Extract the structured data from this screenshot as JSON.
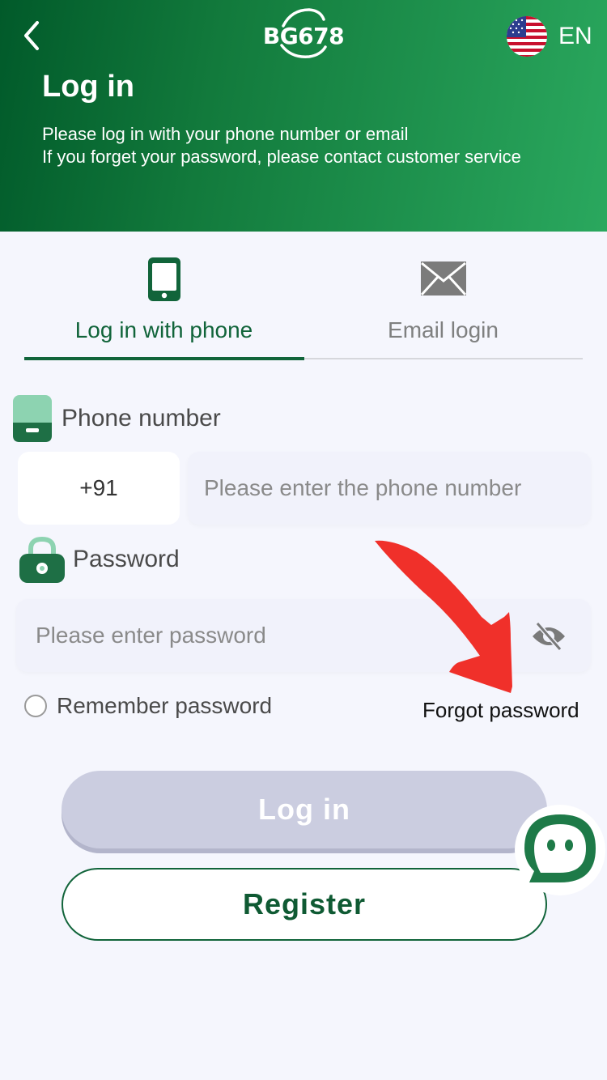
{
  "header": {
    "logo": "BG678",
    "language": "EN",
    "title": "Log in",
    "subtitle_line1": "Please log in with your phone number or email",
    "subtitle_line2": "If you forget your password, please contact customer service"
  },
  "tabs": [
    {
      "label": "Log in with phone",
      "icon": "phone-icon",
      "active": true
    },
    {
      "label": "Email login",
      "icon": "envelope-icon",
      "active": false
    }
  ],
  "phone": {
    "label": "Phone number",
    "country_code": "+91",
    "placeholder": "Please enter the phone number"
  },
  "password": {
    "label": "Password",
    "placeholder": "Please enter password"
  },
  "options": {
    "remember": "Remember password",
    "forgot": "Forgot password"
  },
  "buttons": {
    "login": "Log in",
    "register": "Register"
  },
  "colors": {
    "primary": "#11643a",
    "header_start": "#015a2a",
    "header_end": "#2aa85e",
    "disabled_button": "#cbcde0",
    "annotation_arrow": "#f0302a"
  }
}
